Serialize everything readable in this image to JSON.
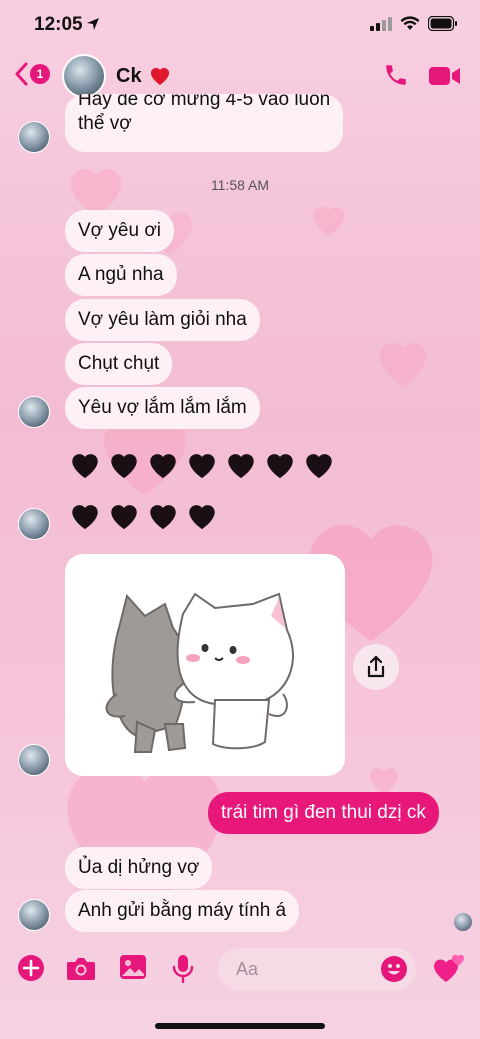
{
  "status_bar": {
    "time": "12:05",
    "icons": [
      "location-arrow-icon",
      "signal-icon",
      "wifi-icon",
      "battery-icon"
    ]
  },
  "header": {
    "back_badge": "1",
    "contact_name": "Ck",
    "name_emoji": "red-heart-icon",
    "actions": [
      "phone-icon",
      "video-call-icon"
    ]
  },
  "messages": {
    "partial_top_line1": "Hay để cơ mừng 4-5 vào luôn",
    "partial_top_line2": "thể vợ",
    "timestamp": "11:58 AM",
    "m1": "Vợ yêu ơi",
    "m2": "A ngủ nha",
    "m3": "Vợ yêu làm giỏi nha",
    "m4": "Chụt chụt",
    "m5": "Yêu vợ lắm lắm lắm",
    "black_hearts_row1": "♥♥♥♥♥♥♥",
    "black_hearts_row2": "♥♥♥♥",
    "sticker": "hugging-cats-sticker",
    "sent": "trái tim gì đen thui dzị ck",
    "m6": "Ủa dị hửng vợ",
    "m7": "Anh gửi bằng máy tính á"
  },
  "composer": {
    "placeholder": "Aa",
    "icons": [
      "plus-icon",
      "camera-icon",
      "gallery-icon",
      "microphone-icon",
      "emoji-icon",
      "hearts-icon"
    ]
  },
  "colors": {
    "accent": "#e6177a",
    "bubble_bg": "#fdf1f6",
    "background": "#f3bcd3"
  }
}
